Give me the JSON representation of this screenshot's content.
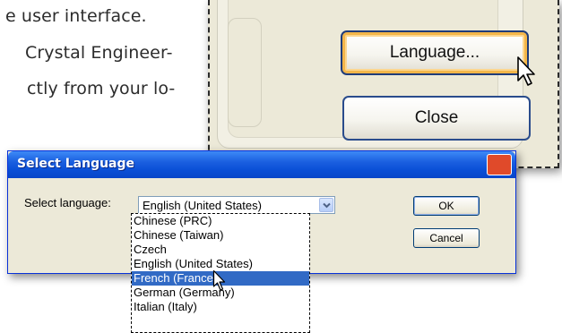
{
  "document": {
    "lines": [
      "e user interface.",
      "Crystal Engineer-",
      "ctly from your lo-"
    ]
  },
  "callout": {
    "language_button": "Language...",
    "close_button": "Close"
  },
  "dialog": {
    "title": "Select Language",
    "label": "Select language:",
    "combo_value": "English (United States)",
    "ok_button": "OK",
    "cancel_button": "Cancel",
    "options": [
      "Chinese (PRC)",
      "Chinese (Taiwan)",
      "Czech",
      "English (United States)",
      "French (France)",
      "German (Germany)",
      "Italian (Italy)"
    ],
    "selected_option": "French (France)"
  },
  "colors": {
    "titlebar": "#0a4fd6",
    "selection": "#316ac5",
    "dialog_bg": "#ece9d8",
    "hover_border": "#f3b64a"
  }
}
